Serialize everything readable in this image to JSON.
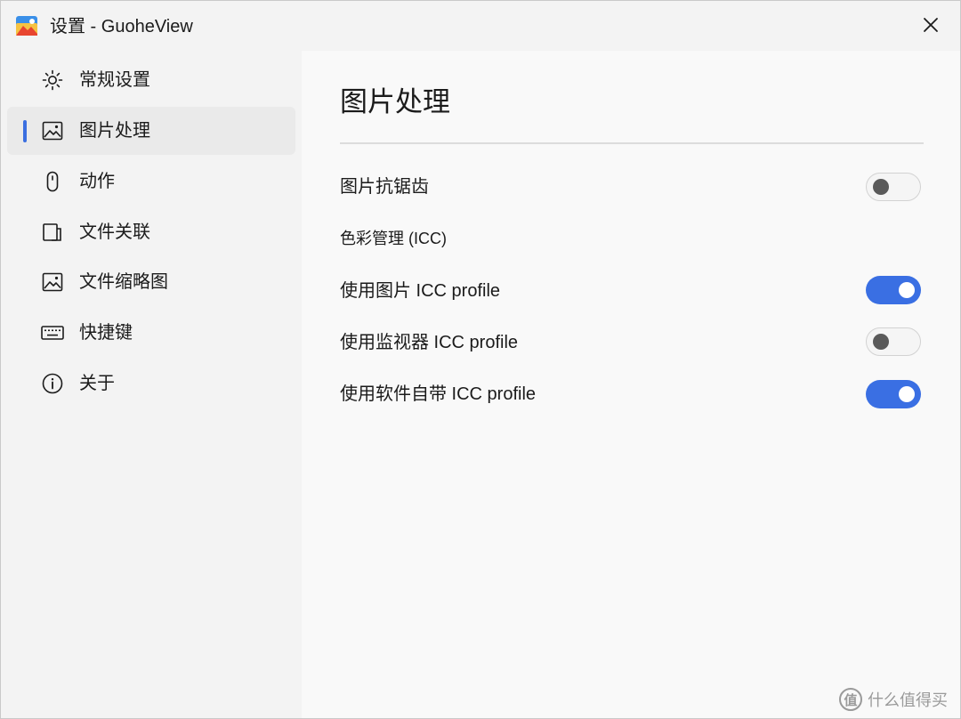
{
  "window": {
    "title": "设置 - GuoheView"
  },
  "sidebar": {
    "items": [
      {
        "label": "常规设置",
        "icon": "gear-icon",
        "active": false
      },
      {
        "label": "图片处理",
        "icon": "image-icon",
        "active": true
      },
      {
        "label": "动作",
        "icon": "mouse-icon",
        "active": false
      },
      {
        "label": "文件关联",
        "icon": "file-link-icon",
        "active": false
      },
      {
        "label": "文件缩略图",
        "icon": "thumbnail-icon",
        "active": false
      },
      {
        "label": "快捷键",
        "icon": "keyboard-icon",
        "active": false
      },
      {
        "label": "关于",
        "icon": "info-icon",
        "active": false
      }
    ]
  },
  "main": {
    "title": "图片处理",
    "settings": [
      {
        "label": "图片抗锯齿",
        "type": "toggle",
        "on": false
      },
      {
        "label": "色彩管理 (ICC)",
        "type": "section"
      },
      {
        "label": "使用图片 ICC profile",
        "type": "toggle",
        "on": true
      },
      {
        "label": "使用监视器 ICC profile",
        "type": "toggle",
        "on": false
      },
      {
        "label": "使用软件自带 ICC profile",
        "type": "toggle",
        "on": true
      }
    ]
  },
  "watermark": {
    "badge": "值",
    "text": "什么值得买"
  },
  "colors": {
    "accent": "#3a6fe3",
    "sidebar_bg": "#f3f3f3",
    "content_bg": "#f9f9f9",
    "active_item_bg": "#eaeaea"
  }
}
